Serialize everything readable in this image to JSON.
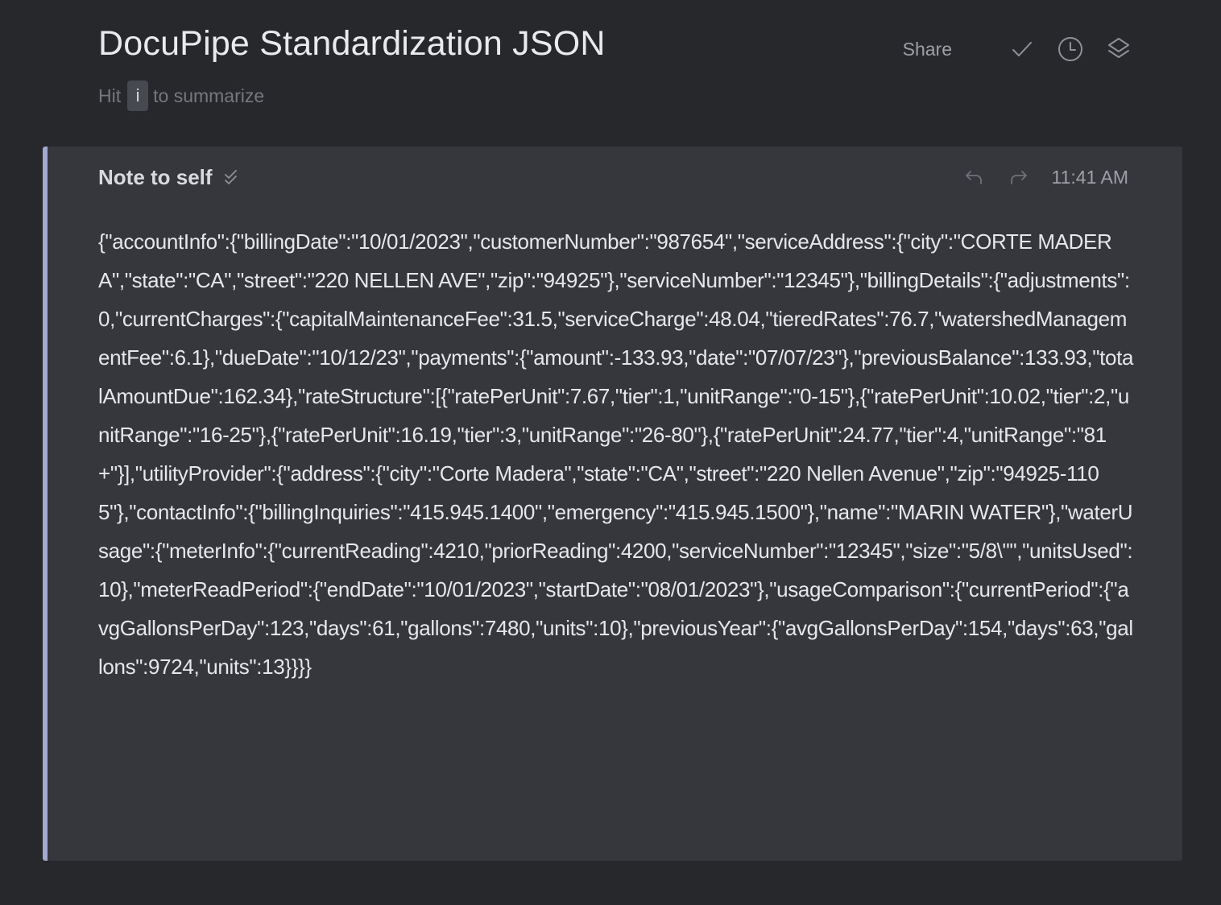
{
  "header": {
    "title": "DocuPipe Standardization JSON",
    "hint_prefix": "Hit",
    "hint_key": "i",
    "hint_suffix": "to summarize",
    "share_label": "Share",
    "icons": [
      "check-icon",
      "clock-icon",
      "layers-icon"
    ]
  },
  "note": {
    "title": "Note to self",
    "timestamp": "11:41 AM",
    "icons": [
      "double-check-icon",
      "undo-icon",
      "redo-icon"
    ],
    "accent_color": "#a4a9cf",
    "content": "{\"accountInfo\":{\"billingDate\":\"10/01/2023\",\"customerNumber\":\"987654\",\"serviceAddress\":{\"city\":\"CORTE MADERA\",\"state\":\"CA\",\"street\":\"220 NELLEN AVE\",\"zip\":\"94925\"},\"serviceNumber\":\"12345\"},\"billingDetails\":{\"adjustments\":0,\"currentCharges\":{\"capitalMaintenanceFee\":31.5,\"serviceCharge\":48.04,\"tieredRates\":76.7,\"watershedManagementFee\":6.1},\"dueDate\":\"10/12/23\",\"payments\":{\"amount\":-133.93,\"date\":\"07/07/23\"},\"previousBalance\":133.93,\"totalAmountDue\":162.34},\"rateStructure\":[{\"ratePerUnit\":7.67,\"tier\":1,\"unitRange\":\"0-15\"},{\"ratePerUnit\":10.02,\"tier\":2,\"unitRange\":\"16-25\"},{\"ratePerUnit\":16.19,\"tier\":3,\"unitRange\":\"26-80\"},{\"ratePerUnit\":24.77,\"tier\":4,\"unitRange\":\"81+\"}],\"utilityProvider\":{\"address\":{\"city\":\"Corte Madera\",\"state\":\"CA\",\"street\":\"220 Nellen Avenue\",\"zip\":\"94925-1105\"},\"contactInfo\":{\"billingInquiries\":\"415.945.1400\",\"emergency\":\"415.945.1500\"},\"name\":\"MARIN WATER\"},\"waterUsage\":{\"meterInfo\":{\"currentReading\":4210,\"priorReading\":4200,\"serviceNumber\":\"12345\",\"size\":\"5/8\\\"\",\"unitsUsed\":10},\"meterReadPeriod\":{\"endDate\":\"10/01/2023\",\"startDate\":\"08/01/2023\"},\"usageComparison\":{\"currentPeriod\":{\"avgGallonsPerDay\":123,\"days\":61,\"gallons\":7480,\"units\":10},\"previousYear\":{\"avgGallonsPerDay\":154,\"days\":63,\"gallons\":9724,\"units\":13}}}}"
  }
}
